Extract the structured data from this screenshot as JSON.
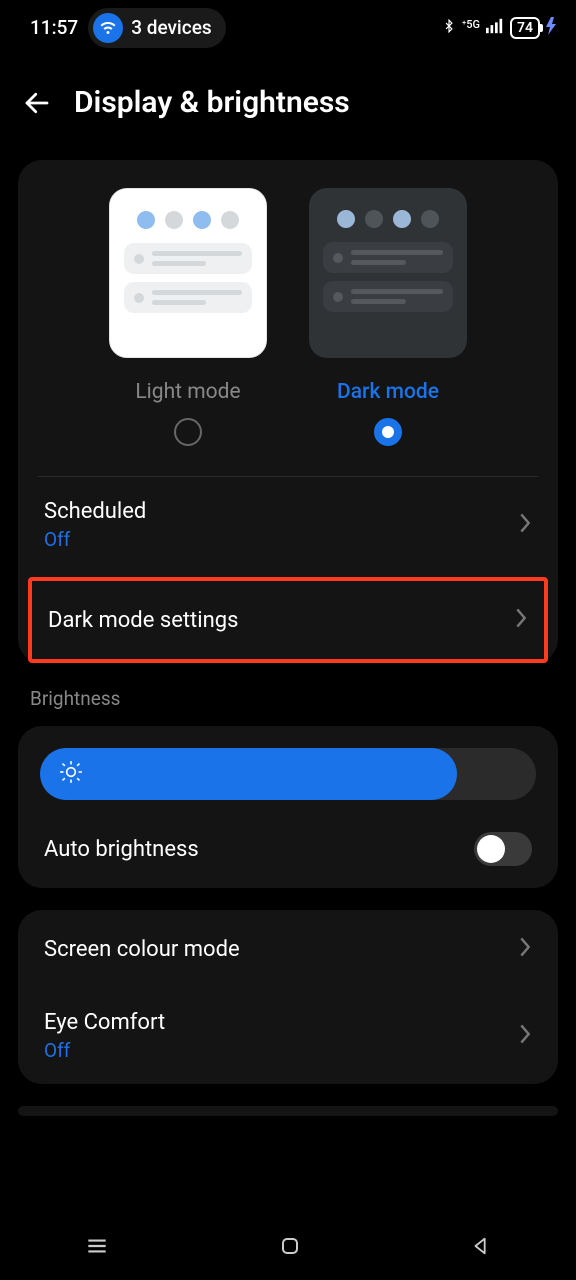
{
  "status": {
    "time": "11:57",
    "devices": "3 devices",
    "battery": "74"
  },
  "header": {
    "title": "Display & brightness"
  },
  "modes": {
    "light": "Light mode",
    "dark": "Dark mode"
  },
  "scheduled": {
    "title": "Scheduled",
    "value": "Off"
  },
  "darkSettings": {
    "title": "Dark mode settings"
  },
  "sections": {
    "brightness": "Brightness"
  },
  "autoBrightness": {
    "title": "Auto brightness"
  },
  "screenColour": {
    "title": "Screen colour mode"
  },
  "eyeComfort": {
    "title": "Eye Comfort",
    "value": "Off"
  }
}
